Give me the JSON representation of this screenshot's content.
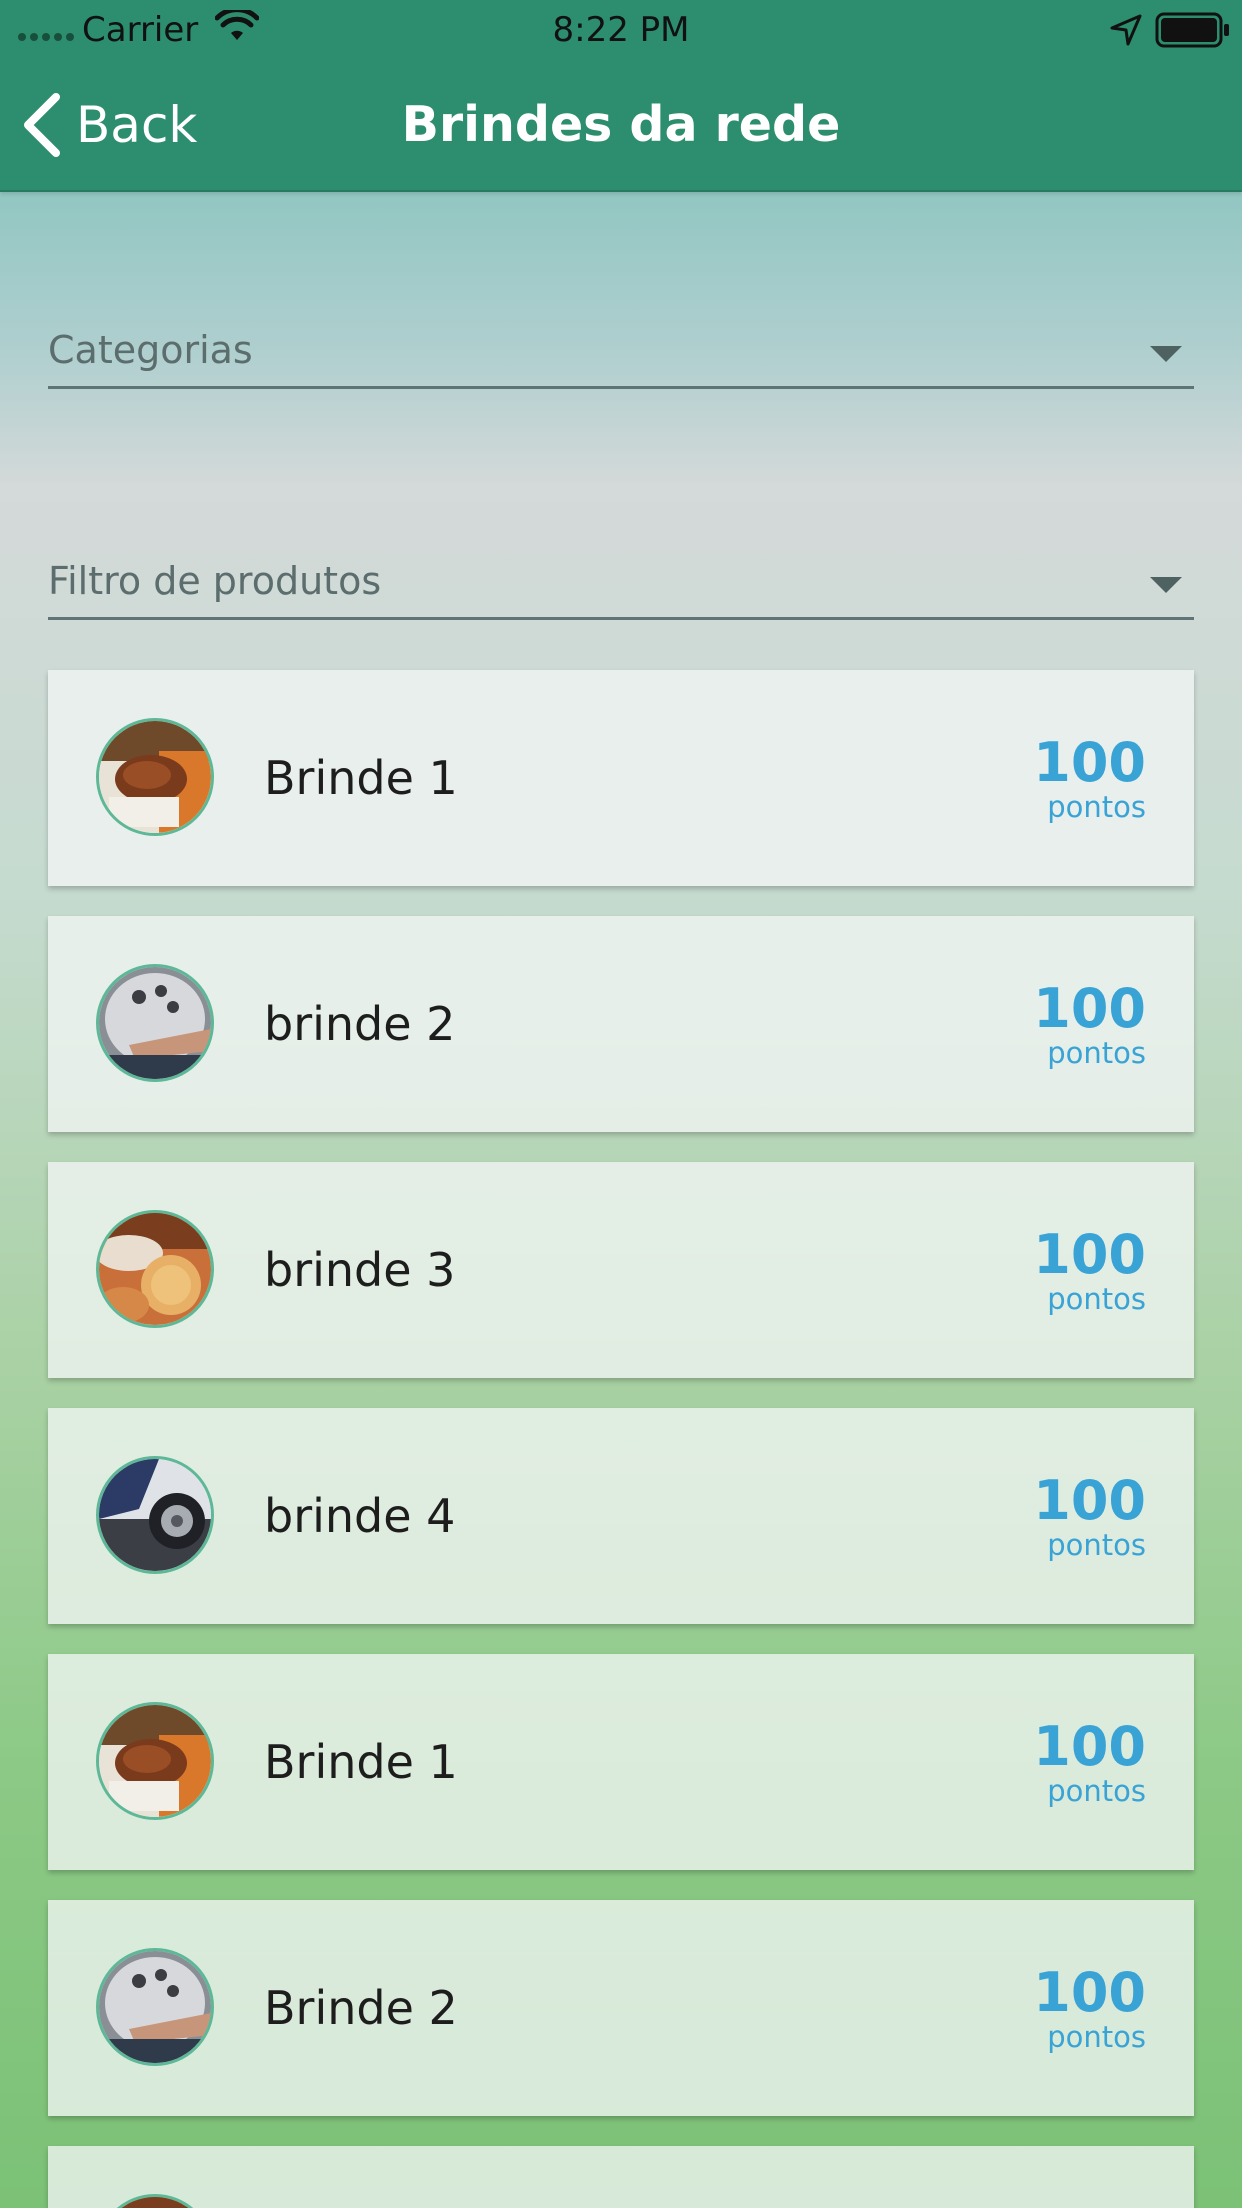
{
  "status_bar": {
    "carrier": "Carrier",
    "time": "8:22 PM",
    "icons": [
      "signal-dots-icon",
      "wifi-icon",
      "location-arrow-icon",
      "battery-icon"
    ]
  },
  "nav": {
    "back_label": "Back",
    "title": "Brindes da rede",
    "back_icon": "chevron-left-icon"
  },
  "filters": {
    "categories_placeholder": "Categorias",
    "products_placeholder": "Filtro de produtos"
  },
  "items": [
    {
      "name": "Brinde 1",
      "points": "100",
      "points_unit": "pontos",
      "image": "steak-thumbnail"
    },
    {
      "name": "brinde 2",
      "points": "100",
      "points_unit": "pontos",
      "image": "wheel-service-thumbnail"
    },
    {
      "name": "brinde 3",
      "points": "100",
      "points_unit": "pontos",
      "image": "bread-thumbnail"
    },
    {
      "name": "brinde 4",
      "points": "100",
      "points_unit": "pontos",
      "image": "tire-thumbnail"
    },
    {
      "name": "Brinde 1",
      "points": "100",
      "points_unit": "pontos",
      "image": "steak-thumbnail"
    },
    {
      "name": "Brinde 2",
      "points": "100",
      "points_unit": "pontos",
      "image": "wheel-service-thumbnail"
    }
  ],
  "colors": {
    "nav_bar": "#2c8e6e",
    "points_text": "#3aa3d6",
    "thumbnail_border": "#5db897"
  }
}
